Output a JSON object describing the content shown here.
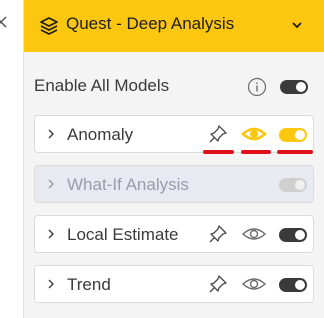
{
  "header": {
    "title": "Quest - Deep Analysis",
    "background_color": "#fcc70e"
  },
  "enable_all": {
    "label": "Enable All Models",
    "enabled": false
  },
  "models": [
    {
      "label": "Anomaly",
      "enabled": true,
      "visible": true,
      "disabled": false
    },
    {
      "label": "What-If Analysis",
      "enabled": false,
      "visible": false,
      "disabled": true
    },
    {
      "label": "Local Estimate",
      "enabled": false,
      "visible": false,
      "disabled": false
    },
    {
      "label": "Trend",
      "enabled": false,
      "visible": false,
      "disabled": false
    }
  ],
  "colors": {
    "accent": "#fcc70e",
    "highlight": "#e0101a"
  }
}
